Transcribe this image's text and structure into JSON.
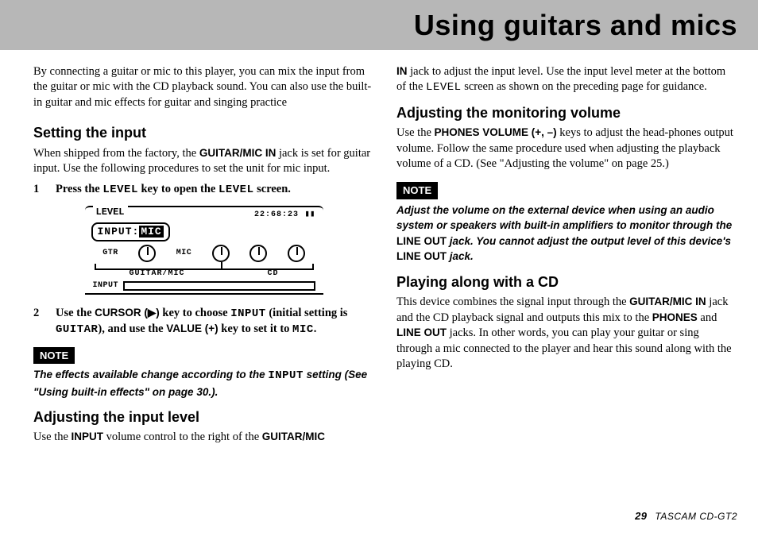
{
  "header": {
    "title": "Using guitars and mics"
  },
  "left": {
    "intro": "By connecting a guitar or mic to this player, you can mix the input from the guitar or mic with the CD playback sound. You can also use the built-in guitar and mic effects for guitar and singing practice",
    "h_setting": "Setting the input",
    "setting_p": "When shipped from the factory, the ",
    "setting_b": "GUITAR/MIC IN",
    "setting_p2": " jack is set for guitar input. Use the following procedures to set the unit for mic input.",
    "step1_num": "1",
    "step1_a": "Press the ",
    "step1_k": "LEVEL",
    "step1_b": " key to open the ",
    "step1_k2": "LEVEL",
    "step1_c": " screen.",
    "step2_num": "2",
    "step2_a": "Use the ",
    "step2_b": "CURSOR (▶)",
    "step2_c": " key to choose ",
    "step2_k": "INPUT",
    "step2_d": " (initial setting is ",
    "step2_k2": "GUITAR",
    "step2_e": "), and use the ",
    "step2_b2": "VALUE (+)",
    "step2_f": " key to set it to ",
    "step2_k3": "MIC",
    "step2_g": ".",
    "note_label": "NOTE",
    "note_body_a": "The effects available change according to the ",
    "note_body_k": "INPUT",
    "note_body_b": " setting (See \"Using built-in effects\" on page 30.).",
    "h_adjlevel": "Adjusting the input level",
    "adjlevel_a": "Use the ",
    "adjlevel_b": "INPUT",
    "adjlevel_c": " volume control to the right of the ",
    "adjlevel_d": "GUITAR/MIC"
  },
  "right": {
    "cont_b": "IN",
    "cont_a": " jack to adjust the input level. Use the input level meter at the bottom of the ",
    "cont_k": "LEVEL",
    "cont_c": " screen as shown on the preceding page for guidance.",
    "h_monvol": "Adjusting the monitoring volume",
    "monvol_a": "Use the ",
    "monvol_b": "PHONES VOLUME (+, –)",
    "monvol_c": " keys to adjust the head-phones output volume. Follow the same procedure used when adjusting the playback volume of a CD. (See \"Adjusting the volume\" on page 25.)",
    "note_label": "NOTE",
    "note_body_a": "Adjust the volume on the external device when using an audio system or speakers with built-in amplifiers to monitor through the ",
    "note_body_b": "LINE OUT",
    "note_body_c": " jack. You cannot adjust the output level of this device's ",
    "note_body_d": "LINE OUT",
    "note_body_e": " jack.",
    "h_play": "Playing along with a CD",
    "play_a": "This device combines the signal input through the ",
    "play_b": "GUITAR/MIC IN",
    "play_c": " jack and the CD playback signal and outputs this mix to the ",
    "play_d": "PHONES",
    "play_e": " and ",
    "play_f": "LINE OUT",
    "play_g": " jacks. In other words, you can play your guitar or sing through a mic connected to the player and hear this sound along with the playing CD."
  },
  "lcd": {
    "title": "LEVEL",
    "time": "22:68:23",
    "input_label": "INPUT:",
    "input_value": "MIC",
    "gtr": "GTR",
    "mic": "MIC",
    "gm": "GUITAR/MIC",
    "cd": "CD",
    "inputfoot": "INPUT"
  },
  "footer": {
    "pagenum": "29",
    "model": "TASCAM  CD-GT2"
  }
}
